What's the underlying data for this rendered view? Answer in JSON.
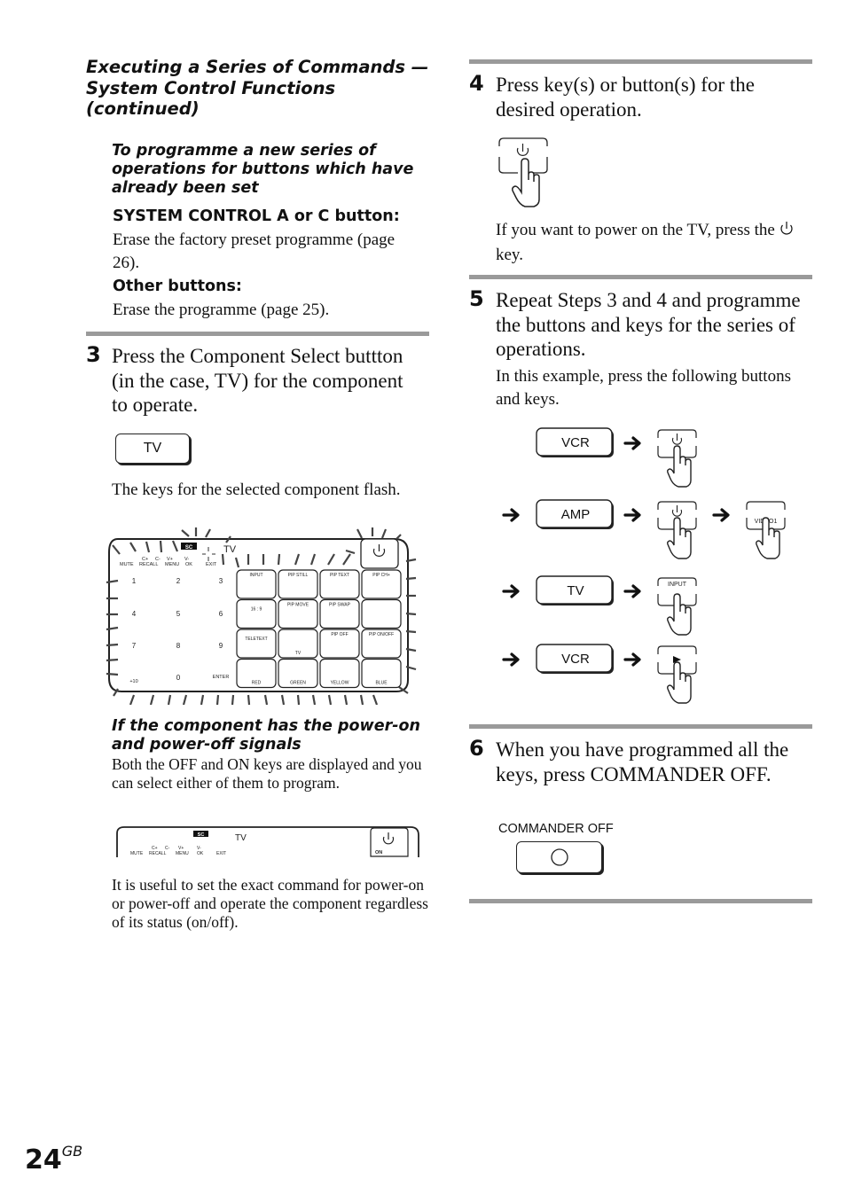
{
  "header": {
    "section_title": "Executing a Series of Commands — System Control Functions (continued)"
  },
  "left": {
    "subheading": "To programme a new series of operations for buttons which have already been set",
    "system_control_label": "SYSTEM CONTROL A or C button:",
    "system_control_text": "Erase the factory preset programme (page 26).",
    "other_buttons_label": "Other buttons:",
    "other_buttons_text": "Erase the programme (page 25).",
    "step3": {
      "number": "3",
      "text": "Press the Component Select buttton (in the case, TV) for the component to operate.",
      "button_label": "TV",
      "note": "The keys for the selected component flash."
    },
    "remote_display": {
      "badge": "SC",
      "component": "TV",
      "top_labels": [
        "MUTE",
        "C+",
        "RECALL",
        "C-",
        "V+",
        "MENU",
        "V-",
        "OK",
        "EXIT"
      ],
      "numpad": [
        "1",
        "2",
        "3",
        "4",
        "5",
        "6",
        "7",
        "8",
        "9",
        "+10",
        "0",
        "ENTER"
      ],
      "grid_keys": [
        [
          "INPUT",
          "PIP STILL",
          "PIP TEXT",
          "PIP CH+"
        ],
        [
          "16 : 9",
          "PIP MOVE",
          "PIP SWAP",
          ""
        ],
        [
          "TELETEXT",
          "TV",
          "PIP OFF",
          "PIP ON/OFF"
        ],
        [
          "RED",
          "GREEN",
          "YELLOW",
          "BLUE"
        ]
      ]
    },
    "power_signals": {
      "heading": "If the component has the power-on and power-off signals",
      "text": "Both the OFF and ON keys are displayed and you can select either of them to program.",
      "strip_on_label": "ON",
      "note": "It is useful to set the exact command for power-on or power-off and operate the component regardless of its status (on/off)."
    }
  },
  "right": {
    "step4": {
      "number": "4",
      "text": "Press key(s) or button(s) for the desired operation.",
      "note_before": "If you want to power on the TV, press the",
      "note_after": "key."
    },
    "step5": {
      "number": "5",
      "text": "Repeat Steps 3 and 4 and programme the buttons and keys for the series of operations.",
      "note": "In this example, press the following buttons and keys.",
      "sequence": [
        {
          "button": "VCR",
          "keys": [
            "power"
          ]
        },
        {
          "button": "AMP",
          "keys": [
            "power",
            "VIDEO1"
          ]
        },
        {
          "button": "TV",
          "keys": [
            "INPUT"
          ]
        },
        {
          "button": "VCR",
          "keys": [
            "►"
          ]
        }
      ]
    },
    "step6": {
      "number": "6",
      "text": "When you have programmed all the keys, press COMMANDER OFF.",
      "button_caption": "COMMANDER OFF"
    }
  },
  "footer": {
    "page_number": "24",
    "page_suffix": "GB"
  }
}
